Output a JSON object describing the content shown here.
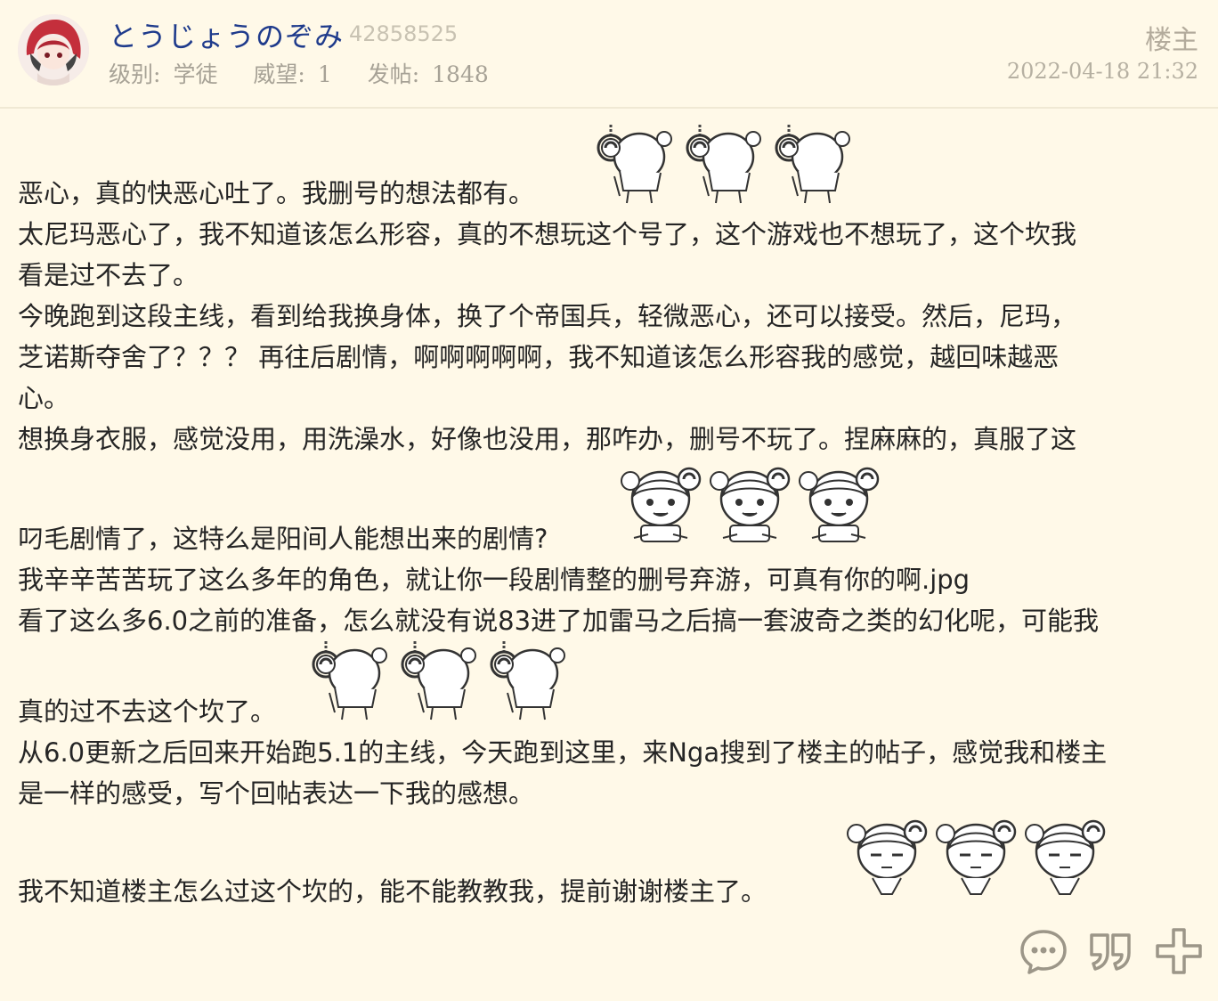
{
  "author": {
    "name": "とうじょうのぞみ",
    "uid": "42858525",
    "level_label": "级别:",
    "level": "学徒",
    "prestige_label": "威望:",
    "prestige": "1",
    "posts_label": "发帖:",
    "posts": "1848"
  },
  "post": {
    "floor": "楼主",
    "time": "2022-04-18 21:32",
    "lines": [
      "恶心，真的快恶心吐了。我删号的想法都有。",
      "太尼玛恶心了，我不知道该怎么形容，真的不想玩这个号了，这个游戏也不想玩了，这个坎我",
      "看是过不去了。",
      "今晚跑到这段主线，看到给我换身体，换了个帝国兵，轻微恶心，还可以接受。然后，尼玛，",
      "芝诺斯夺舍了？？？ 再往后剧情，啊啊啊啊啊，我不知道该怎么形容我的感觉，越回味越恶",
      "心。",
      "想换身衣服，感觉没用，用洗澡水，好像也没用，那咋办，删号不玩了。捏麻麻的，真服了这",
      "叼毛剧情了，这特么是阳间人能想出来的剧情?",
      "我辛辛苦苦玩了这么多年的角色，就让你一段剧情整的删号弃游，可真有你的啊.jpg",
      "看了这么多6.0之前的准备，怎么就没有说83进了加雷马之后搞一套波奇之类的幻化呢，可能我",
      "真的过不去这个坎了。",
      "从6.0更新之后回来开始跑5.1的主线，今天跑到这里，来Nga搜到了楼主的帖子，感觉我和楼主",
      "是一样的感受，写个回帖表达一下我的感想。",
      "我不知道楼主怎么过这个坎的，能不能教教我，提前谢谢楼主了。"
    ]
  },
  "stickers": {
    "hanging": "hanging-sticker",
    "smile": "smile-sticker",
    "sad": "sad-sticker"
  },
  "actions": {
    "comment": "comment-icon",
    "quote": "quote-icon",
    "add": "add-icon"
  },
  "colors": {
    "background": "#fff9e8",
    "username": "#1f3b8c",
    "muted": "#a7a296"
  }
}
